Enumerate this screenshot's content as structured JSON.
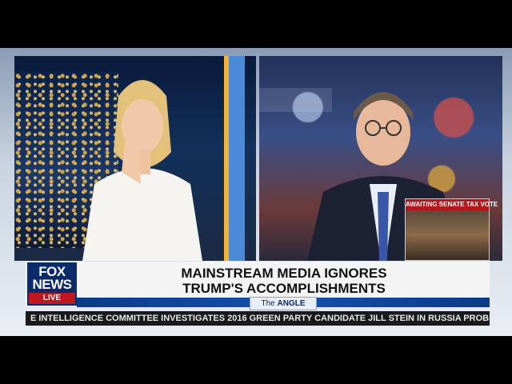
{
  "channel": {
    "logo_line1": "FOX",
    "logo_line2": "NEWS",
    "live_label": "LIVE"
  },
  "headline": {
    "line1": "MAINSTREAM MEDIA IGNORES",
    "line2": "TRUMP'S ACCOMPLISHMENTS"
  },
  "show": {
    "prefix": "The",
    "name": "ANGLE"
  },
  "pip": {
    "title": "AWAITING SENATE TAX VOTE"
  },
  "ticker": {
    "text": "E INTELLIGENCE COMMITTEE INVESTIGATES 2016 GREEN PARTY CANDIDATE JILL STEIN IN RUSSIA PROBE..."
  },
  "icons": [
    "fox-news-logo"
  ],
  "colors": {
    "brand_blue": "#0a2a6a",
    "live_red": "#c0161e",
    "show_bar_blue": "#1650b0",
    "lower_third_bg": "#f4f4f4",
    "ticker_bg": "#1a1a1a"
  }
}
